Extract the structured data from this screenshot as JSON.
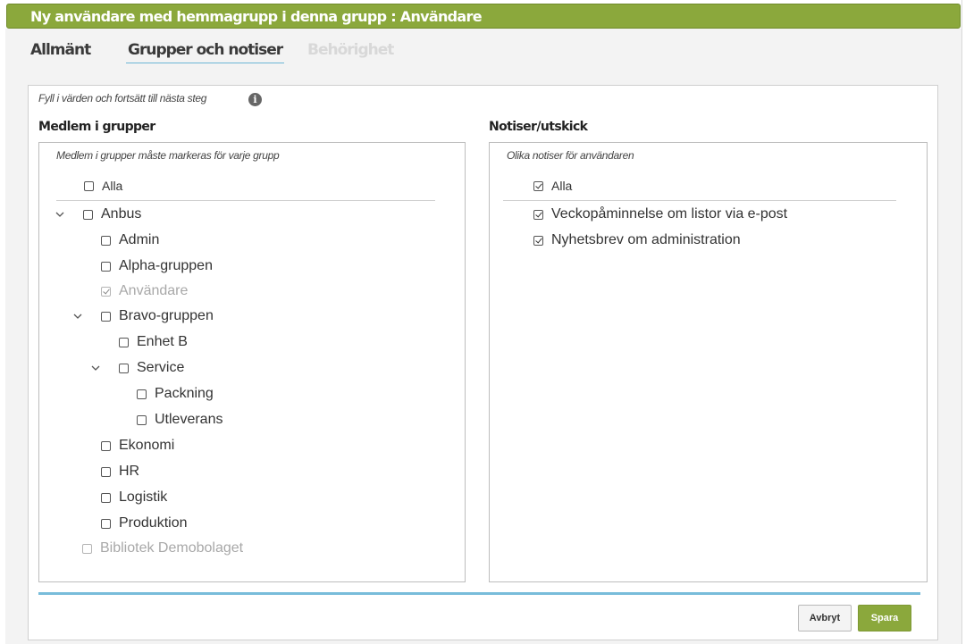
{
  "dialog": {
    "title": "Ny användare med hemmagrupp i denna grupp : Användare"
  },
  "tabs": [
    {
      "label": "Allmänt",
      "state": "normal"
    },
    {
      "label": "Grupper och notiser",
      "state": "active"
    },
    {
      "label": "Behörighet",
      "state": "disabled"
    }
  ],
  "form": {
    "hint": "Fyll i värden och fortsätt till nästa steg",
    "info_icon": "info-icon"
  },
  "groups": {
    "title": "Medlem i grupper",
    "hint": "Medlem i grupper måste markeras för varje grupp",
    "all_label": "Alla",
    "items": [
      {
        "label": "Anbus",
        "checked": false,
        "expanded": true,
        "disabled": false
      },
      {
        "label": "Admin",
        "checked": false,
        "disabled": false
      },
      {
        "label": "Alpha-gruppen",
        "checked": false,
        "disabled": false
      },
      {
        "label": "Användare",
        "checked": true,
        "disabled": true
      },
      {
        "label": "Bravo-gruppen",
        "checked": false,
        "expanded": true,
        "disabled": false
      },
      {
        "label": "Enhet B",
        "checked": false,
        "disabled": false
      },
      {
        "label": "Service",
        "checked": false,
        "expanded": true,
        "disabled": false
      },
      {
        "label": "Packning",
        "checked": false,
        "disabled": false
      },
      {
        "label": "Utleverans",
        "checked": false,
        "disabled": false
      },
      {
        "label": "Ekonomi",
        "checked": false,
        "disabled": false
      },
      {
        "label": "HR",
        "checked": false,
        "disabled": false
      },
      {
        "label": "Logistik",
        "checked": false,
        "disabled": false
      },
      {
        "label": "Produktion",
        "checked": false,
        "disabled": false
      },
      {
        "label": "Bibliotek Demobolaget",
        "checked": false,
        "disabled": true
      }
    ]
  },
  "notices": {
    "title": "Notiser/utskick",
    "hint": "Olika notiser för användaren",
    "all_label": "Alla",
    "items": [
      {
        "label": "Veckopåminnelse om listor via e-post",
        "checked": true
      },
      {
        "label": "Nyhetsbrev om administration",
        "checked": true
      }
    ]
  },
  "buttons": {
    "cancel": "Avbryt",
    "save": "Spara"
  },
  "colors": {
    "accent_green": "#8ba83c",
    "tab_underline": "#6cb6d6",
    "footer_line": "#78bcda"
  }
}
